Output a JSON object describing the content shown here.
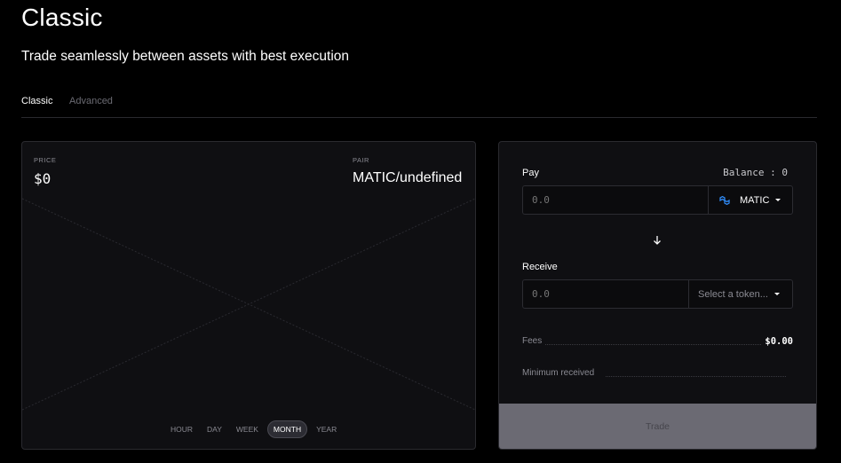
{
  "header": {
    "title": "Classic",
    "subtitle": "Trade seamlessly between assets with best execution"
  },
  "tabs": [
    {
      "label": "Classic",
      "active": true
    },
    {
      "label": "Advanced",
      "active": false
    }
  ],
  "chart": {
    "price_label": "PRICE",
    "price_value": "$0",
    "pair_label": "PAIR",
    "pair_value": "MATIC/undefined",
    "ranges": [
      {
        "label": "HOUR",
        "active": false
      },
      {
        "label": "DAY",
        "active": false
      },
      {
        "label": "WEEK",
        "active": false
      },
      {
        "label": "MONTH",
        "active": true
      },
      {
        "label": "YEAR",
        "active": false
      }
    ]
  },
  "trade": {
    "pay_label": "Pay",
    "balance_text": "Balance : 0",
    "pay_placeholder": "0.0",
    "pay_token": "MATIC",
    "pay_token_icon": "polygon-matic-icon",
    "receive_label": "Receive",
    "receive_placeholder": "0.0",
    "receive_token_placeholder": "Select a token...",
    "fees_label": "Fees",
    "fees_value": "$0.00",
    "min_received_label": "Minimum received",
    "min_received_value": "",
    "trade_button": "Trade"
  },
  "colors": {
    "background": "#000000",
    "panel": "#0f0f12",
    "accent_matic": "#2f8af5",
    "trade_button_disabled": "#6b6a73"
  }
}
